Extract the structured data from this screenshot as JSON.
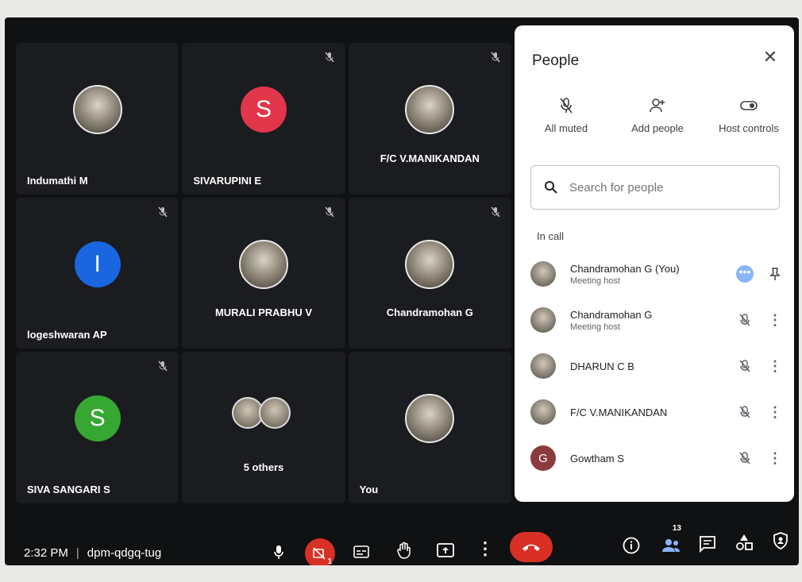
{
  "tiles": [
    {
      "name": "Indumathi M",
      "avatar": "photo",
      "muted": false
    },
    {
      "name": "SIVARUPINI E",
      "avatar": "S",
      "color": "#e2364b",
      "muted": true
    },
    {
      "name": "F/C V.MANIKANDAN",
      "avatar": "photo",
      "muted": true
    },
    {
      "name": "logeshwaran AP",
      "avatar": "I",
      "color": "#1a66e0",
      "muted": true
    },
    {
      "name": "MURALI PRABHU V",
      "avatar": "photo",
      "muted": true
    },
    {
      "name": "Chandramohan G",
      "avatar": "photo",
      "muted": true
    },
    {
      "name": "SIVA SANGARI S",
      "avatar": "S",
      "color": "#36a832",
      "muted": true
    },
    {
      "name": "5 others",
      "avatar": "group",
      "muted": false
    },
    {
      "name": "You",
      "avatar": "photo",
      "muted": false
    }
  ],
  "panel": {
    "title": "People",
    "actions": [
      {
        "label": "All muted",
        "icon": "mic-off-icon"
      },
      {
        "label": "Add people",
        "icon": "add-person-icon"
      },
      {
        "label": "Host controls",
        "icon": "toggle-icon"
      }
    ],
    "search_placeholder": "Search for people",
    "section": "In call",
    "people": [
      {
        "name": "Chandramohan G (You)",
        "sub": "Meeting host",
        "action": "more-badge-icon",
        "action2": "pin-icon"
      },
      {
        "name": "Chandramohan G",
        "sub": "Meeting host",
        "action": "mic-off-icon",
        "action2": "more-vert-icon"
      },
      {
        "name": "DHARUN C B",
        "sub": "",
        "action": "mic-off-icon",
        "action2": "more-vert-icon"
      },
      {
        "name": "F/C V.MANIKANDAN",
        "sub": "",
        "action": "mic-off-icon",
        "action2": "more-vert-icon"
      },
      {
        "name": "Gowtham S",
        "sub": "",
        "letter": "G",
        "action": "mic-off-icon",
        "action2": "more-vert-icon"
      }
    ]
  },
  "bottom": {
    "time": "2:32 PM",
    "meeting_code": "dpm-qdgq-tug",
    "people_count": "13",
    "cam_badge": "1"
  },
  "colors": {
    "end_call": "#d93025",
    "accent": "#8ab4f8"
  }
}
